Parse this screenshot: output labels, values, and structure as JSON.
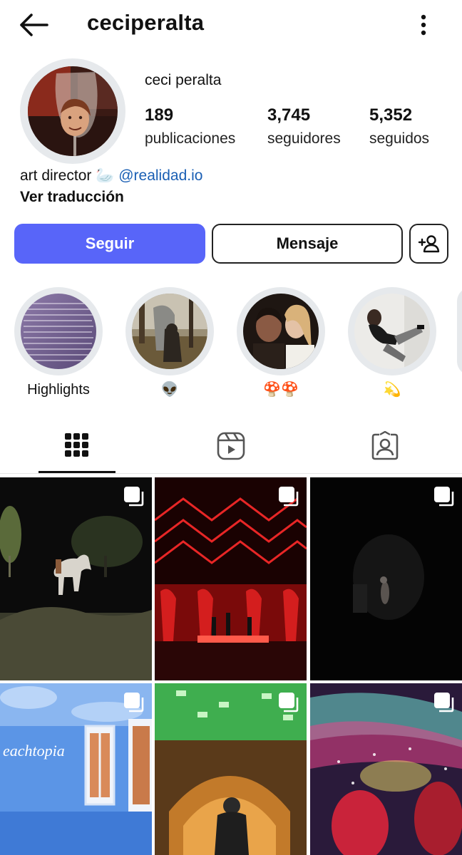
{
  "header": {
    "username": "ceciperalta",
    "back_icon": "arrow-left-icon",
    "more_icon": "more-vertical-icon"
  },
  "profile": {
    "display_name": "ceci peralta",
    "stats": {
      "posts": {
        "value": "189",
        "label": "publicaciones"
      },
      "followers": {
        "value": "3,745",
        "label": "seguidores"
      },
      "following": {
        "value": "5,352",
        "label": "seguidos"
      }
    },
    "bio": {
      "text": "art director",
      "emoji": "🦢",
      "mention": "@realidad.io"
    },
    "translate_link": "Ver traducción"
  },
  "actions": {
    "follow": "Seguir",
    "message": "Mensaje",
    "suggest_icon": "add-person-icon"
  },
  "highlights": [
    {
      "label": "Highlights"
    },
    {
      "label": "👽"
    },
    {
      "label": "🍄🍄"
    },
    {
      "label": "💫"
    }
  ],
  "tabs": [
    {
      "name": "grid",
      "icon": "grid-icon",
      "selected": true
    },
    {
      "name": "reels",
      "icon": "reels-icon",
      "selected": false
    },
    {
      "name": "tagged",
      "icon": "tagged-person-icon",
      "selected": false
    }
  ],
  "posts": [
    {
      "multiple": true
    },
    {
      "multiple": true
    },
    {
      "multiple": true
    },
    {
      "multiple": true
    },
    {
      "multiple": true
    },
    {
      "multiple": true
    }
  ],
  "colors": {
    "primary_button": "#5865f9",
    "link": "#1a5fb4",
    "ring": "#e6e9ec"
  }
}
